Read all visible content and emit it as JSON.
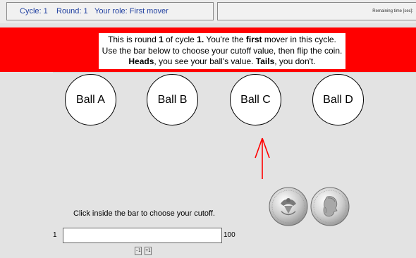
{
  "header": {
    "cycle": "Cycle: 1",
    "round": "Round: 1",
    "role": "Your role: First mover",
    "timer_label": "Remaining time [sec]:",
    "timer_value": ""
  },
  "banner": {
    "line1": {
      "a": "This is round ",
      "b": "1",
      "c": " of cycle ",
      "d": "1.",
      "e": " You're the ",
      "f": "first",
      "g": " mover in this cycle."
    },
    "line2": "Use the bar below to choose your cutoff value, then flip the coin.",
    "line3": {
      "a": "Heads",
      "b": ", you see your ball's value. ",
      "c": "Tails",
      "d": ", you don't."
    }
  },
  "balls": [
    "Ball A",
    "Ball B",
    "Ball C",
    "Ball D"
  ],
  "coin": {
    "heads_icon": "quarter-heads-icon",
    "tails_icon": "quarter-tails-icon"
  },
  "cutoff": {
    "instruction": "Click inside the bar to choose your cutoff.",
    "min_label": "1",
    "max_label": "100",
    "minus_label": "-1",
    "plus_label": "+1"
  },
  "colors": {
    "banner": "#ff0000",
    "arrow": "#ff0000",
    "header_text": "#1f3fa0"
  }
}
